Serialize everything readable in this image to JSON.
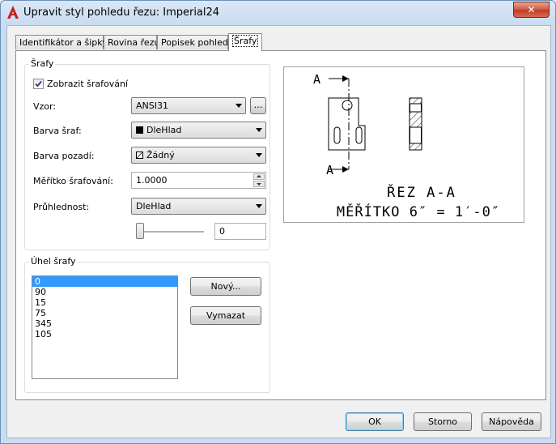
{
  "window": {
    "title": "Upravit styl pohledu řezu: Imperial24",
    "close_label": "✕"
  },
  "tabs": [
    {
      "label": "Identifikátor a šipky"
    },
    {
      "label": "Rovina řezu"
    },
    {
      "label": "Popisek pohledu"
    },
    {
      "label": "Šrafy"
    }
  ],
  "hatch_group": {
    "title": "Šrafy",
    "show_hatch": {
      "label": "Zobrazit šrafování",
      "checked": true
    },
    "pattern": {
      "label": "Vzor:",
      "value": "ANSI31",
      "browse_label": "..."
    },
    "hatch_color": {
      "label": "Barva šraf:",
      "value": "DleHlad",
      "swatch": "#000000"
    },
    "background_color": {
      "label": "Barva pozadí:",
      "value": "Žádný"
    },
    "hatch_scale": {
      "label": "Měřítko šrafování:",
      "value": "1.0000"
    },
    "transparency": {
      "label": "Průhlednost:",
      "value": "DleHlad",
      "slider_value": "0",
      "slider_fraction": 0
    }
  },
  "angle_group": {
    "title": "Úhel šrafy",
    "angles": [
      "0",
      "90",
      "15",
      "75",
      "345",
      "105"
    ],
    "selected_index": 0,
    "new_label": "Nový...",
    "delete_label": "Vymazat"
  },
  "preview": {
    "label_top": "A",
    "label_bottom": "A",
    "caption_line1": "ŘEZ A-A",
    "caption_line2": "MĚŘÍTKO 6″ = 1′-0″"
  },
  "footer": {
    "ok_label": "OK",
    "cancel_label": "Storno",
    "help_label": "Nápověda"
  },
  "colors": {
    "accent_red": "#c0231c",
    "selection": "#3399ff",
    "title_bg": "#c9dcf1"
  }
}
